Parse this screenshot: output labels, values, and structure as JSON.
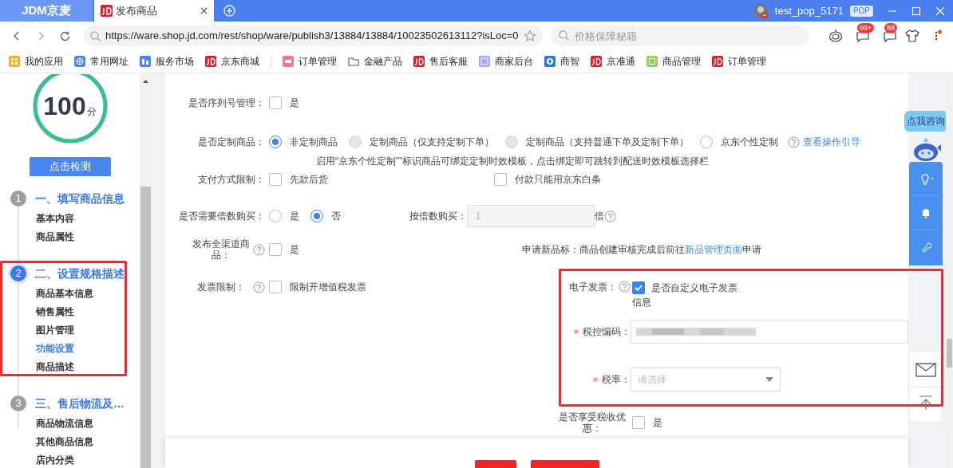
{
  "browser": {
    "tabs": [
      {
        "label": "JDM京麦",
        "kind": "logo",
        "selected": false
      },
      {
        "label": "发布商品",
        "kind": "page",
        "selected": true
      }
    ],
    "user": "test_pop_5171",
    "user_badge": "POP",
    "url": "https://ware.shop.jd.com/rest/shop/ware/publish3/13884/13884/10023502613112?isLoc=0",
    "search_placeholder": "价格保障秘籍",
    "badges": [
      "99+",
      "88"
    ],
    "bookmarks": [
      {
        "label": "我的应用",
        "kind": "apps"
      },
      {
        "label": "常用网址",
        "kind": "globe"
      },
      {
        "label": "服务市场",
        "kind": "market"
      },
      {
        "label": "京东商城",
        "kind": "jd"
      },
      {
        "label": "订单管理",
        "kind": "order"
      },
      {
        "label": "金融产品",
        "kind": "folder"
      },
      {
        "label": "售后客服",
        "kind": "jd"
      },
      {
        "label": "商家后台",
        "kind": "admin"
      },
      {
        "label": "商智",
        "kind": "smart"
      },
      {
        "label": "京准通",
        "kind": "jd"
      },
      {
        "label": "商品管理",
        "kind": "goods"
      },
      {
        "label": "订单管理",
        "kind": "jd"
      }
    ]
  },
  "sidebar": {
    "score": "100",
    "score_unit": "分",
    "check_button": "点击检测",
    "steps": [
      {
        "number": "1",
        "title": "一、填写商品信息",
        "active": false,
        "items": [
          {
            "label": "基本内容",
            "selected": false
          },
          {
            "label": "商品属性",
            "selected": false
          }
        ]
      },
      {
        "number": "2",
        "title": "二、设置规格描述",
        "active": true,
        "items": [
          {
            "label": "商品基本信息",
            "selected": false
          },
          {
            "label": "销售属性",
            "selected": false
          },
          {
            "label": "图片管理",
            "selected": false
          },
          {
            "label": "功能设置",
            "selected": true
          },
          {
            "label": "商品描述",
            "selected": false
          }
        ]
      },
      {
        "number": "3",
        "title": "三、售后物流及…",
        "active": false,
        "items": [
          {
            "label": "商品物流信息",
            "selected": false
          },
          {
            "label": "其他商品信息",
            "selected": false
          },
          {
            "label": "店内分类",
            "selected": false
          }
        ]
      }
    ]
  },
  "form": {
    "rows": [
      {
        "left": {
          "kind": "checkbox",
          "label": "是否序列号管理：",
          "options": [
            {
              "label": "是",
              "checked": false
            }
          ]
        }
      },
      {
        "left": {
          "kind": "radio",
          "label": "是否定制商品：",
          "options": [
            {
              "label": "非定制商品",
              "selected": true,
              "disabled": false
            },
            {
              "label": "定制商品（仅支持定制下单）",
              "selected": false,
              "disabled": true
            },
            {
              "label": "定制商品（支持普通下单及定制下单）",
              "selected": false,
              "disabled": true
            },
            {
              "label": "京东个性定制",
              "selected": false,
              "disabled": false
            }
          ],
          "link": "查看操作引导",
          "note": "启用“京东个性定制””标识商品可绑定定制时效模板，点击绑定即可跳转到配送时效模板选择栏"
        }
      },
      {
        "left": {
          "kind": "checkbox",
          "label": "支付方式限制：",
          "options": [
            {
              "label": "先款后货",
              "checked": false
            },
            {
              "label": "付款只能用京东白条",
              "checked": false
            }
          ]
        }
      },
      {
        "left": {
          "kind": "radio",
          "label": "是否需要倍数购买：",
          "options": [
            {
              "label": "是",
              "selected": false,
              "disabled": false
            },
            {
              "label": "否",
              "selected": true,
              "disabled": false
            }
          ]
        },
        "right": {
          "kind": "number",
          "label": "按倍数购买：",
          "value": "1",
          "disabled": true,
          "suffix": "倍"
        }
      },
      {
        "left": {
          "kind": "checkbox",
          "label": "发布全渠道商品：",
          "help": true,
          "options": [
            {
              "label": "是",
              "checked": false
            }
          ]
        },
        "right": {
          "kind": "info",
          "label": "申请新品标：",
          "text": "商品创建审核完成后前往",
          "link": "新品管理页面",
          "text_after": "申请"
        }
      },
      {
        "left": {
          "kind": "checkbox",
          "label": "发票限制：",
          "help": true,
          "options": [
            {
              "label": "限制开增值税发票",
              "checked": false
            }
          ]
        },
        "right": {
          "kind": "checkbox",
          "label": "电子发票：",
          "help": true,
          "options": [
            {
              "label": "是否自定义电子发票信息",
              "checked": true
            }
          ]
        }
      },
      {
        "right": {
          "kind": "input",
          "label": "税控编码：",
          "required": true,
          "redacted": true
        }
      },
      {
        "right": {
          "kind": "select",
          "label": "税率：",
          "required": true,
          "placeholder": "请选择"
        }
      },
      {
        "right": {
          "kind": "checkbox",
          "label": "是否享受税收优惠：",
          "options": [
            {
              "label": "是",
              "checked": false
            }
          ]
        }
      }
    ]
  },
  "assistant": {
    "label": "点我咨询"
  }
}
